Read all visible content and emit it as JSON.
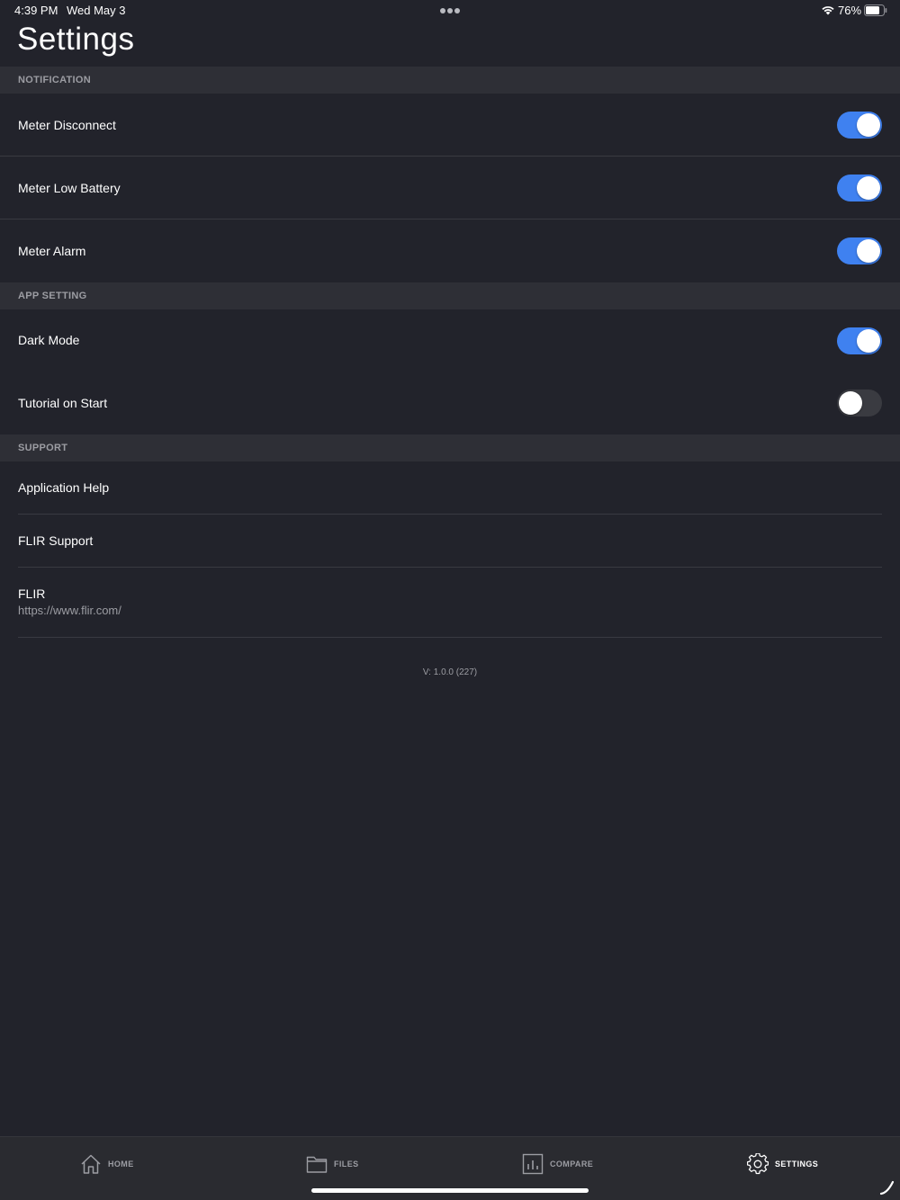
{
  "status_bar": {
    "time": "4:39 PM",
    "date": "Wed May 3",
    "battery": "76%"
  },
  "page": {
    "title": "Settings"
  },
  "sections": {
    "notification": {
      "header": "NOTIFICATION",
      "meter_disconnect": {
        "label": "Meter Disconnect",
        "enabled": true
      },
      "meter_low_battery": {
        "label": "Meter Low Battery",
        "enabled": true
      },
      "meter_alarm": {
        "label": "Meter Alarm",
        "enabled": true
      }
    },
    "app_setting": {
      "header": "APP SETTING",
      "dark_mode": {
        "label": "Dark Mode",
        "enabled": true
      },
      "tutorial_on_start": {
        "label": "Tutorial on Start",
        "enabled": false
      }
    },
    "support": {
      "header": "SUPPORT",
      "application_help": "Application Help",
      "flir_support": "FLIR Support",
      "flir": {
        "label": "FLIR",
        "url": "https://www.flir.com/"
      }
    }
  },
  "version": "V: 1.0.0 (227)",
  "tab_bar": {
    "home": {
      "label": "HOME",
      "icon": "home-icon"
    },
    "files": {
      "label": "FILES",
      "icon": "folder-icon"
    },
    "compare": {
      "label": "COMPARE",
      "icon": "chart-icon"
    },
    "settings": {
      "label": "SETTINGS",
      "icon": "gear-icon",
      "active": true
    }
  },
  "colors": {
    "background": "#22232b",
    "section_header": "#2e2f36",
    "toggle_on": "#3f81f0",
    "toggle_off": "#3a3b41",
    "muted_text": "#9c9da3"
  }
}
